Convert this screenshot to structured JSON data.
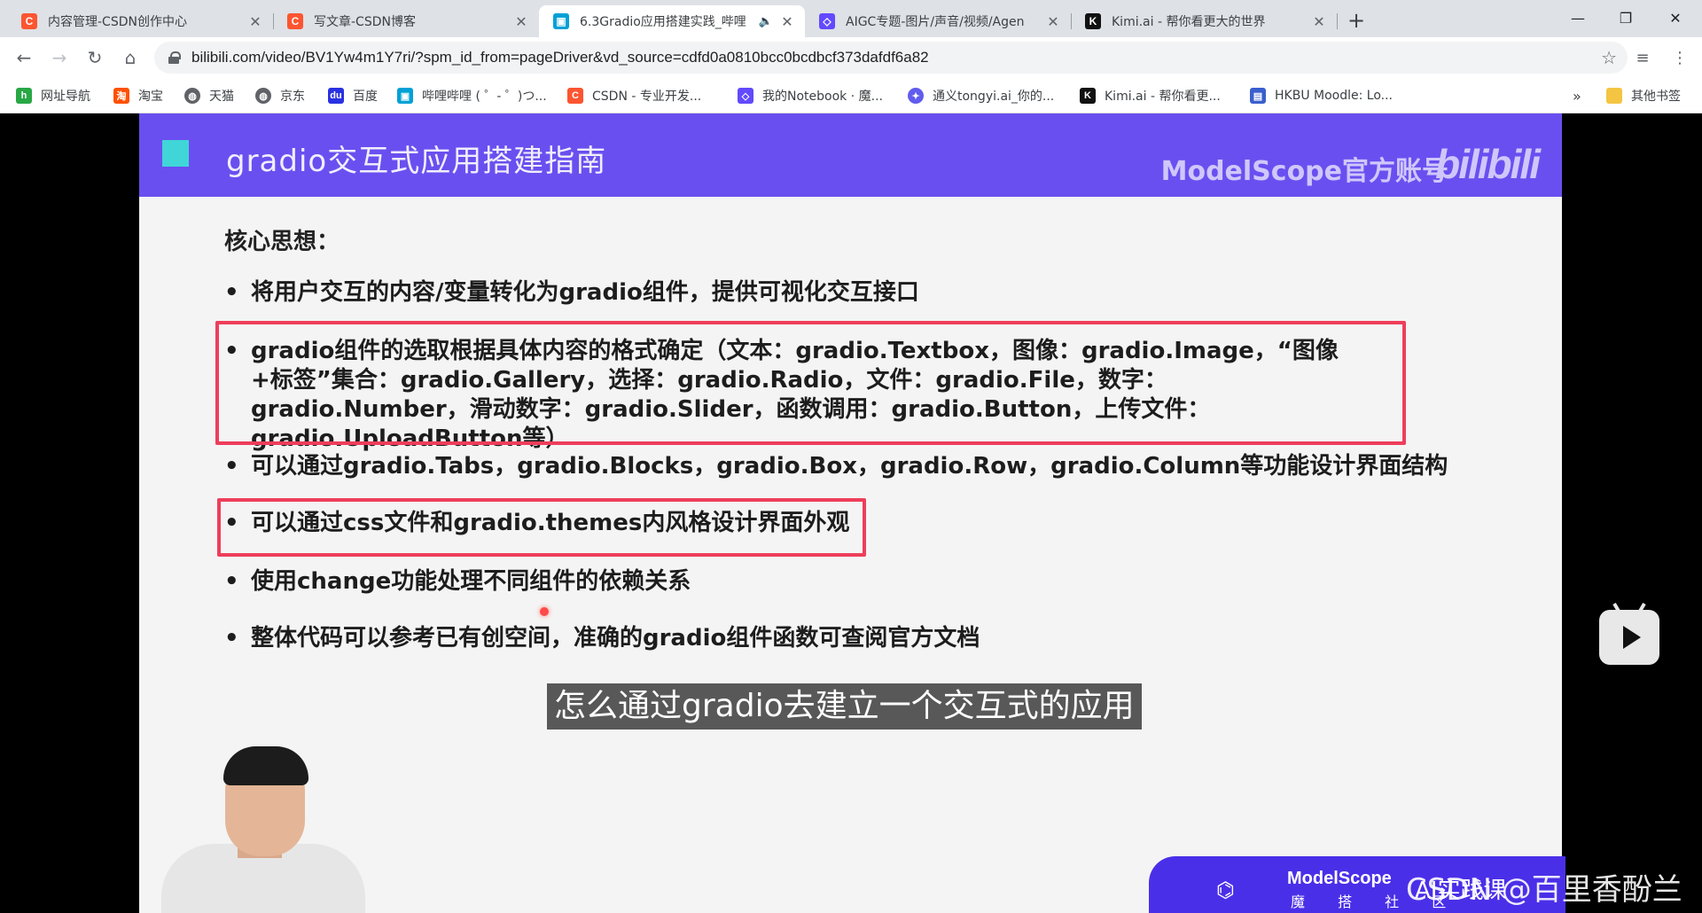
{
  "tabs": [
    {
      "title": "内容管理-CSDN创作中心",
      "icon": "csdn-icon",
      "color": "#fc5531"
    },
    {
      "title": "写文章-CSDN博客",
      "icon": "csdn-icon",
      "color": "#fc5531"
    },
    {
      "title": "6.3Gradio应用搭建实践_哔哩",
      "icon": "bilibili-icon",
      "color": "#00a1d6",
      "active": true
    },
    {
      "title": "AIGC专题-图片/声音/视频/Agen",
      "icon": "modelscope-icon",
      "color": "#624aff"
    },
    {
      "title": "Kimi.ai - 帮你看更大的世界",
      "icon": "kimi-icon",
      "color": "#111111"
    }
  ],
  "address": {
    "url": "bilibili.com/video/BV1Yw4m1Y7ri/?spm_id_from=pageDriver&vd_source=cdfd0a0810bcc0bcdbcf373dafdf6a82"
  },
  "bookmarks": [
    {
      "label": "网址导航",
      "icon": "hao123-icon",
      "color": "#28a745"
    },
    {
      "label": "淘宝",
      "icon": "taobao-icon",
      "color": "#ff5000"
    },
    {
      "label": "天猫",
      "icon": "globe-icon",
      "color": "#5f6368"
    },
    {
      "label": "京东",
      "icon": "globe-icon",
      "color": "#5f6368"
    },
    {
      "label": "百度",
      "icon": "baidu-icon",
      "color": "#2932e1"
    },
    {
      "label": "哔哩哔哩 ( ゜- ゜)つ...",
      "icon": "bilibili-icon",
      "color": "#00a1d6"
    },
    {
      "label": "CSDN - 专业开发...",
      "icon": "csdn-icon",
      "color": "#fc5531"
    },
    {
      "label": "我的Notebook · 魔...",
      "icon": "modelscope-icon",
      "color": "#624aff"
    },
    {
      "label": "通义tongyi.ai_你的...",
      "icon": "tongyi-icon",
      "color": "#615ced"
    },
    {
      "label": "Kimi.ai - 帮你看更...",
      "icon": "kimi-icon",
      "color": "#111111"
    },
    {
      "label": "HKBU Moodle: Lo...",
      "icon": "moodle-icon",
      "color": "#3a5fcd"
    }
  ],
  "bookmarks_overflow": "»",
  "other_bookmarks": "其他书签",
  "slide": {
    "title": "gradio交互式应用搭建指南",
    "brand": "ModelScope官方账号",
    "brand_logo": "bilibili",
    "core_heading": "核心思想：",
    "bullets": [
      "将用户交互的内容/变量转化为gradio组件，提供可视化交互接口",
      "gradio组件的选取根据具体内容的格式确定（文本：gradio.Textbox，图像：gradio.Image，“图像+标签”集合：gradio.Gallery，选择：gradio.Radio，文件：gradio.File，数字：gradio.Number，滑动数字：gradio.Slider，函数调用：gradio.Button，上传文件：gradio.UploadButton等）",
      "可以通过gradio.Tabs，gradio.Blocks，gradio.Box，gradio.Row，gradio.Column等功能设计界面结构",
      "可以通过css文件和gradio.themes内风格设计界面外观",
      "使用change功能处理不同组件的依赖关系",
      "整体代码可以参考已有创空间，准确的gradio组件函数可查阅官方文档"
    ],
    "highlight_color": "#ee3e5b"
  },
  "video": {
    "subtitle": "怎么通过gradio去建立一个交互式的应用",
    "banner_logo": "ModelScope",
    "banner_sub": "魔 搭 社 区",
    "watermark": "CSDN @百里香酚兰",
    "corner_text": "AI实践课"
  }
}
